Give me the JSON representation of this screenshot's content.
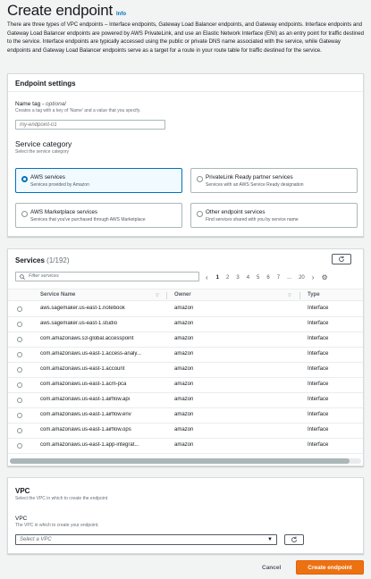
{
  "page": {
    "title": "Create endpoint",
    "info": "Info",
    "intro": "There are three types of VPC endpoints – Interface endpoints, Gateway Load Balancer endpoints, and Gateway endpoints. Interface endpoints and Gateway Load Balancer endpoints are powered by AWS PrivateLink, and use an Elastic Network Interface (ENI) as an entry point for traffic destined to the service. Interface endpoints are typically accessed using the public or private DNS name associated with the service, while Gateway endpoints and Gateway Load Balancer endpoints serve as a target for a route in your route table for traffic destined for the service."
  },
  "endpoint_settings": {
    "title": "Endpoint settings",
    "name_tag_label": "Name tag - ",
    "name_tag_optional": "optional",
    "name_tag_desc": "Creates a tag with a key of 'Name' and a value that you specify.",
    "name_tag_placeholder": "my-endpoint-01",
    "service_category_title": "Service category",
    "service_category_desc": "Select the service category",
    "tiles": [
      {
        "label": "AWS services",
        "desc": "Services provided by Amazon",
        "selected": true
      },
      {
        "label": "PrivateLink Ready partner services",
        "desc": "Services with an AWS Service Ready designation",
        "selected": false
      },
      {
        "label": "AWS Marketplace services",
        "desc": "Services that you've purchased through AWS Marketplace",
        "selected": false
      },
      {
        "label": "Other endpoint services",
        "desc": "Find services shared with you by service name",
        "selected": false
      }
    ]
  },
  "services": {
    "title": "Services",
    "count": "(1/192)",
    "filter_placeholder": "Filter services",
    "pages": [
      "1",
      "2",
      "3",
      "4",
      "5",
      "6",
      "7",
      "...",
      "20"
    ],
    "current_page": "1",
    "columns": {
      "name": "Service Name",
      "owner": "Owner",
      "type": "Type"
    },
    "rows": [
      {
        "name": "aws.sagemaker.us-east-1.notebook",
        "owner": "amazon",
        "type": "Interface"
      },
      {
        "name": "aws.sagemaker.us-east-1.studio",
        "owner": "amazon",
        "type": "Interface"
      },
      {
        "name": "com.amazonaws.s3-global.accesspoint",
        "owner": "amazon",
        "type": "Interface"
      },
      {
        "name": "com.amazonaws.us-east-1.access-analy...",
        "owner": "amazon",
        "type": "Interface"
      },
      {
        "name": "com.amazonaws.us-east-1.account",
        "owner": "amazon",
        "type": "Interface"
      },
      {
        "name": "com.amazonaws.us-east-1.acm-pca",
        "owner": "amazon",
        "type": "Interface"
      },
      {
        "name": "com.amazonaws.us-east-1.airflow.api",
        "owner": "amazon",
        "type": "Interface"
      },
      {
        "name": "com.amazonaws.us-east-1.airflow.env",
        "owner": "amazon",
        "type": "Interface"
      },
      {
        "name": "com.amazonaws.us-east-1.airflow.ops",
        "owner": "amazon",
        "type": "Interface"
      },
      {
        "name": "com.amazonaws.us-east-1.app-integrat...",
        "owner": "amazon",
        "type": "Interface"
      }
    ]
  },
  "vpc": {
    "title": "VPC",
    "desc": "Select the VPC in which to create the endpoint",
    "label": "VPC",
    "field_desc": "The VPC in which to create your endpoint.",
    "placeholder": "Select a VPC"
  },
  "footer": {
    "cancel": "Cancel",
    "create": "Create endpoint"
  },
  "colors": {
    "primary": "#ec7211",
    "link": "#0073bb"
  }
}
